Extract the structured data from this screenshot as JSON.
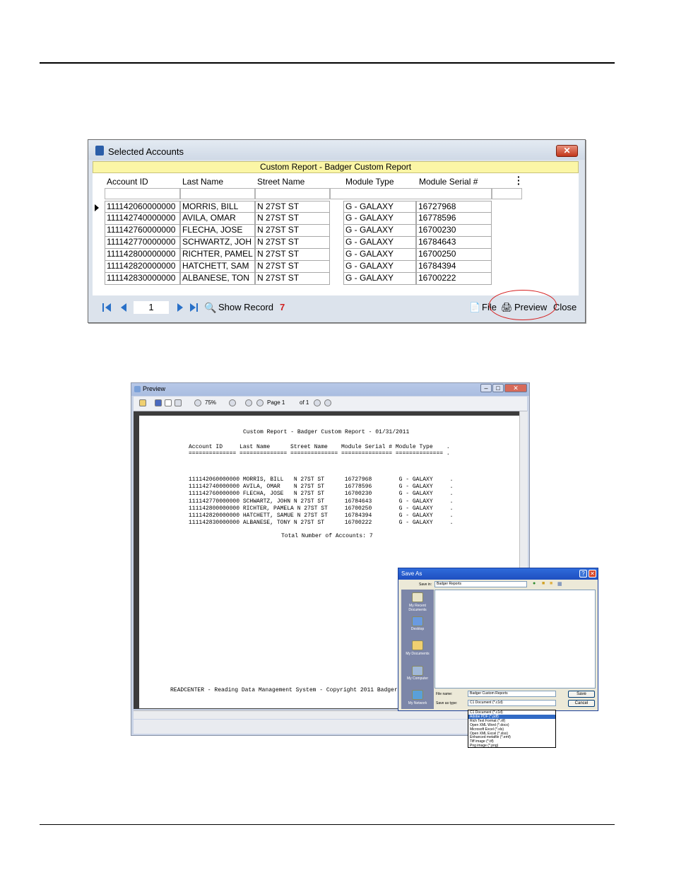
{
  "selected_accounts": {
    "title": "Selected Accounts",
    "close_glyph": "✕",
    "report_title": "Custom Report - Badger Custom Report",
    "columns": [
      "Account ID",
      "Last Name",
      "Street Name",
      "Module Type",
      "Module Serial #"
    ],
    "rows": [
      {
        "account_id": "111142060000000",
        "last_name": "MORRIS, BILL",
        "street": "N 27ST ST",
        "module_type": "G - GALAXY",
        "serial": "16727968"
      },
      {
        "account_id": "111142740000000",
        "last_name": "AVILA, OMAR",
        "street": "N 27ST ST",
        "module_type": "G - GALAXY",
        "serial": "16778596"
      },
      {
        "account_id": "111142760000000",
        "last_name": "FLECHA, JOSE",
        "street": "N 27ST ST",
        "module_type": "G - GALAXY",
        "serial": "16700230"
      },
      {
        "account_id": "111142770000000",
        "last_name": "SCHWARTZ, JOH",
        "street": "N 27ST ST",
        "module_type": "G - GALAXY",
        "serial": "16784643"
      },
      {
        "account_id": "111142800000000",
        "last_name": "RICHTER, PAMEL",
        "street": "N 27ST ST",
        "module_type": "G - GALAXY",
        "serial": "16700250"
      },
      {
        "account_id": "111142820000000",
        "last_name": "HATCHETT, SAM",
        "street": "N 27ST ST",
        "module_type": "G - GALAXY",
        "serial": "16784394"
      },
      {
        "account_id": "111142830000000",
        "last_name": "ALBANESE, TON",
        "street": "N 27ST ST",
        "module_type": "G - GALAXY",
        "serial": "16700222"
      }
    ],
    "toolbar": {
      "page_value": "1",
      "show_record_label": "Show Record",
      "record_count": "7",
      "file_label": "File",
      "preview_label": "Preview",
      "close_label": "Close"
    }
  },
  "preview": {
    "title": "Preview",
    "zoom": "75%",
    "page_label": "Page 1",
    "of_label": "of 1",
    "report_heading": "Custom Report - Badger Custom Report - 01/31/2011",
    "header_line": "Account ID     Last Name      Street Name    Module Serial # Module Type    .",
    "underline_line": "============== ============== ============== =============== ============== .",
    "rows": [
      "111142060000000 MORRIS, BILL   N 27ST ST      16727968        G - GALAXY     .",
      "111142740000000 AVILA, OMAR    N 27ST ST      16778596        G - GALAXY     .",
      "111142760000000 FLECHA, JOSE   N 27ST ST      16700230        G - GALAXY     .",
      "111142770000000 SCHWARTZ, JOHN N 27ST ST      16784643        G - GALAXY     .",
      "111142800000000 RICHTER, PAMELA N 27ST ST     16700250        G - GALAXY     .",
      "111142820000000 HATCHETT, SAMUE N 27ST ST     16784394        G - GALAXY     .",
      "111142830000000 ALBANESE, TONY N 27ST ST      16700222        G - GALAXY     ."
    ],
    "total_line": "Total Number of Accounts: 7",
    "footer_line": "READCENTER - Reading Data Management System - Copyright 2011 Badger"
  },
  "save_as": {
    "title": "Save As",
    "save_in_label": "Save in:",
    "save_in_value": "Badger Reports",
    "places": [
      "My Recent Documents",
      "Desktop",
      "My Documents",
      "My Computer",
      "My Network"
    ],
    "file_name_label": "File name:",
    "file_name_value": "Badger Custom Reports",
    "save_as_type_label": "Save as type:",
    "save_as_type_value": "C1 Document (*.c1d)",
    "save_button": "Save",
    "cancel_button": "Cancel",
    "type_options": [
      "C1 Document (*.c1d)",
      "Adobe PDF (*.pdf)",
      "Rich Text Format (*.rtf)",
      "Open XML Word (*.docx)",
      "Microsoft Excel (*.xls)",
      "Open XML Excel (*.xlsx)",
      "Enhanced metafile (*.emf)",
      "Tiff image (*.tif)",
      "Png image (*.png)"
    ],
    "selected_option_index": 1
  },
  "colors": {
    "report_title_bg": "#fbf6a6",
    "nav_blue": "#2870c8",
    "highlight_circle": "#d62020",
    "selection_blue": "#316ac5"
  }
}
